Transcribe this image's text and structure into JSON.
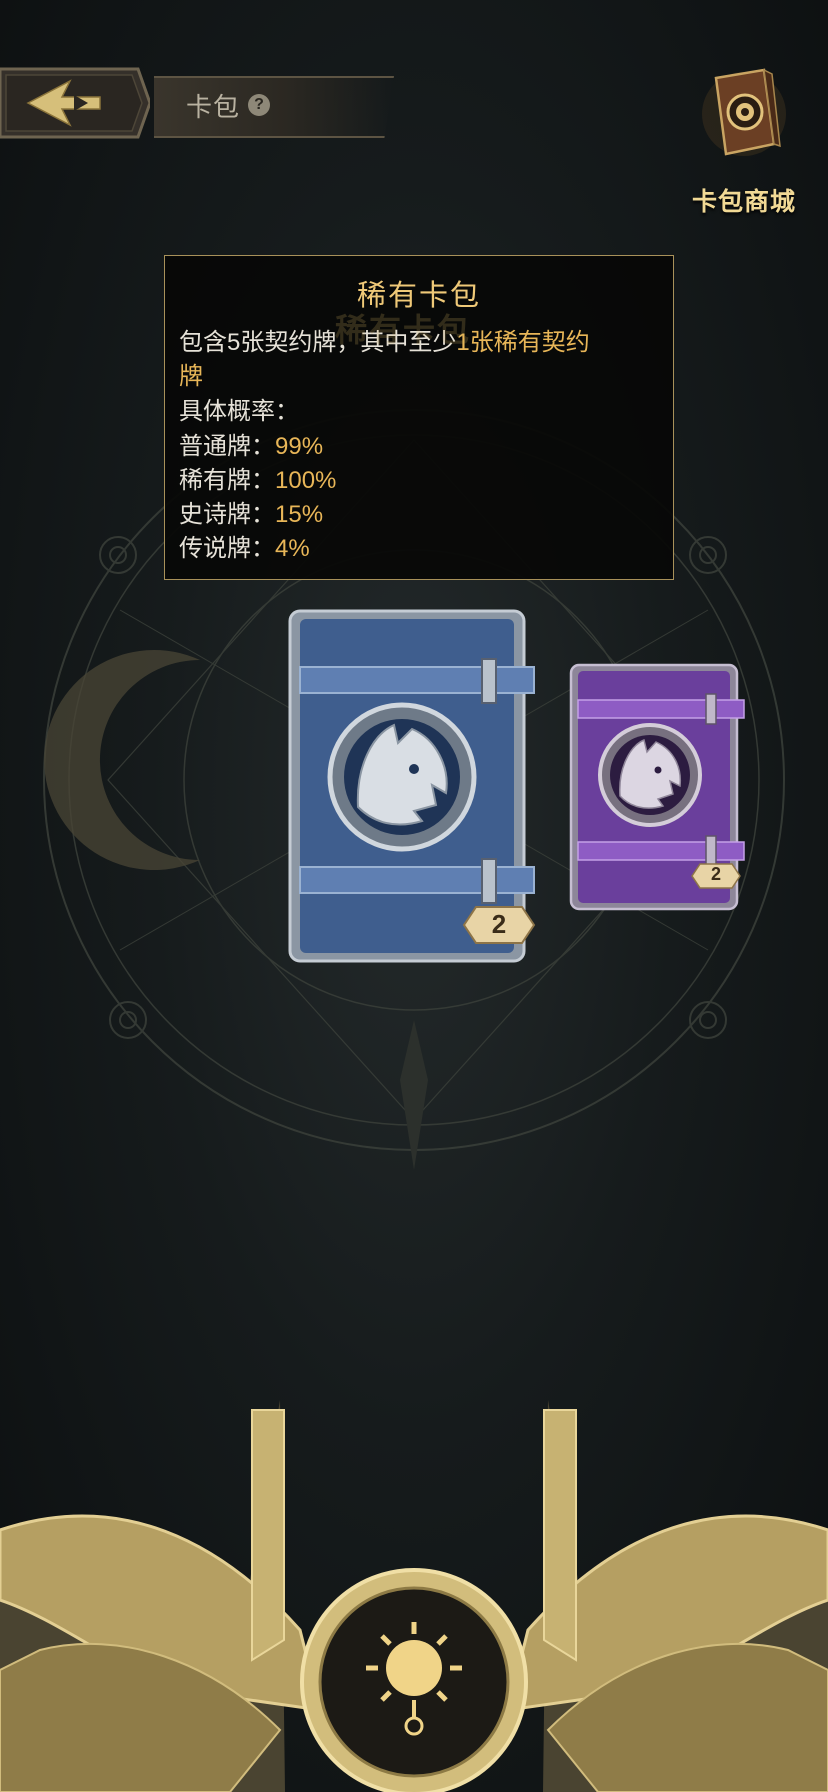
{
  "header": {
    "title": "卡包",
    "help_symbol": "?",
    "back_icon": "back-arrow-icon"
  },
  "shop": {
    "label": "卡包商城",
    "icon": "card-book-icon"
  },
  "tooltip": {
    "title": "稀有卡包",
    "ghost_text": "稀有卡包",
    "desc_prefix": "包含5张契约牌，其中至少",
    "desc_highlight": "1张稀有契约",
    "desc_highlight_wrap": "牌",
    "prob_header": "具体概率：",
    "rows": [
      {
        "label": "普通牌：",
        "value": "99%"
      },
      {
        "label": "稀有牌：",
        "value": "100%"
      },
      {
        "label": "史诗牌：",
        "value": "15%"
      },
      {
        "label": "传说牌：",
        "value": "4%"
      }
    ]
  },
  "packs": [
    {
      "type": "rare",
      "color": "#3f5e8e",
      "count": "2",
      "emblem": "wolf-emblem-icon"
    },
    {
      "type": "epic",
      "color": "#6a3f9c",
      "count": "2",
      "emblem": "wolf-emblem-icon"
    }
  ],
  "colors": {
    "accent_gold": "#e8b658",
    "title_gold": "#efc978",
    "text": "#e6e2d8"
  }
}
